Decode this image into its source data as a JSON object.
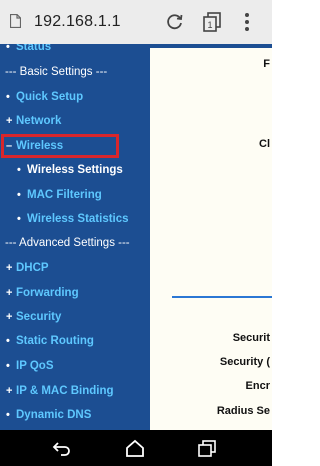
{
  "browser": {
    "url": "192.168.1.1",
    "tab_count": "1"
  },
  "sidebar": {
    "items": [
      {
        "label": "Status",
        "bullet": "•",
        "kind": "item"
      },
      {
        "label": "--- Basic Settings ---",
        "bullet": "",
        "kind": "section"
      },
      {
        "label": "Quick Setup",
        "bullet": "•",
        "kind": "item"
      },
      {
        "label": "Network",
        "bullet": "+",
        "kind": "item"
      },
      {
        "label": "Wireless",
        "bullet": "–",
        "kind": "item",
        "highlighted": true
      },
      {
        "label": "Wireless Settings",
        "bullet": "•",
        "kind": "sub",
        "active": true
      },
      {
        "label": "MAC Filtering",
        "bullet": "•",
        "kind": "sub"
      },
      {
        "label": "Wireless Statistics",
        "bullet": "•",
        "kind": "sub"
      },
      {
        "label": "--- Advanced Settings ---",
        "bullet": "",
        "kind": "section"
      },
      {
        "label": "DHCP",
        "bullet": "+",
        "kind": "item"
      },
      {
        "label": "Forwarding",
        "bullet": "+",
        "kind": "item"
      },
      {
        "label": "Security",
        "bullet": "+",
        "kind": "item"
      },
      {
        "label": "Static Routing",
        "bullet": "•",
        "kind": "item"
      },
      {
        "label": "IP QoS",
        "bullet": "•",
        "kind": "item"
      },
      {
        "label": "IP & MAC Binding",
        "bullet": "+",
        "kind": "item"
      },
      {
        "label": "Dynamic DNS",
        "bullet": "•",
        "kind": "item"
      }
    ]
  },
  "content": {
    "clipped_labels": [
      "F",
      "Cl",
      "Securit",
      "Security (",
      "Encr",
      "Radius Se"
    ]
  },
  "colors": {
    "sidebar_bg": "#1c4e92",
    "link": "#5ec8ff",
    "highlight_border": "#d8262c",
    "content_bg": "#fefdf4"
  }
}
